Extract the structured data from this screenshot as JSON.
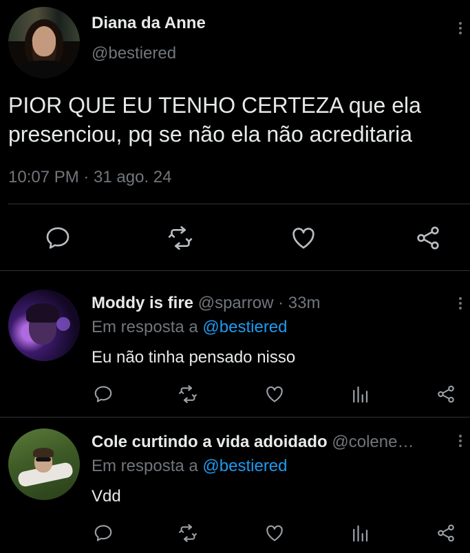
{
  "main_tweet": {
    "display_name": "Diana da Anne",
    "handle": "@bestiered",
    "text": "PIOR QUE EU TENHO CERTEZA que ela presenciou, pq se não ela não acreditaria",
    "timestamp": "10:07 PM · 31 ago. 24",
    "actions": [
      "reply-icon",
      "retweet-icon",
      "like-icon",
      "share-icon"
    ]
  },
  "replies": [
    {
      "display_name": "Moddy is fire",
      "handle": "@sparrow",
      "time": "· 33m",
      "in_reply_prefix": "Em resposta a",
      "in_reply_handle": "@bestiered",
      "text": "Eu não tinha pensado nisso"
    },
    {
      "display_name": "Cole curtindo a vida adoidado",
      "handle": "@colene…",
      "in_reply_prefix": "Em resposta a",
      "in_reply_handle": "@bestiered",
      "text": "Vdd"
    }
  ],
  "colors": {
    "background": "#000000",
    "text": "#e7e9ea",
    "muted": "#71767b",
    "link": "#1d9bf0"
  }
}
